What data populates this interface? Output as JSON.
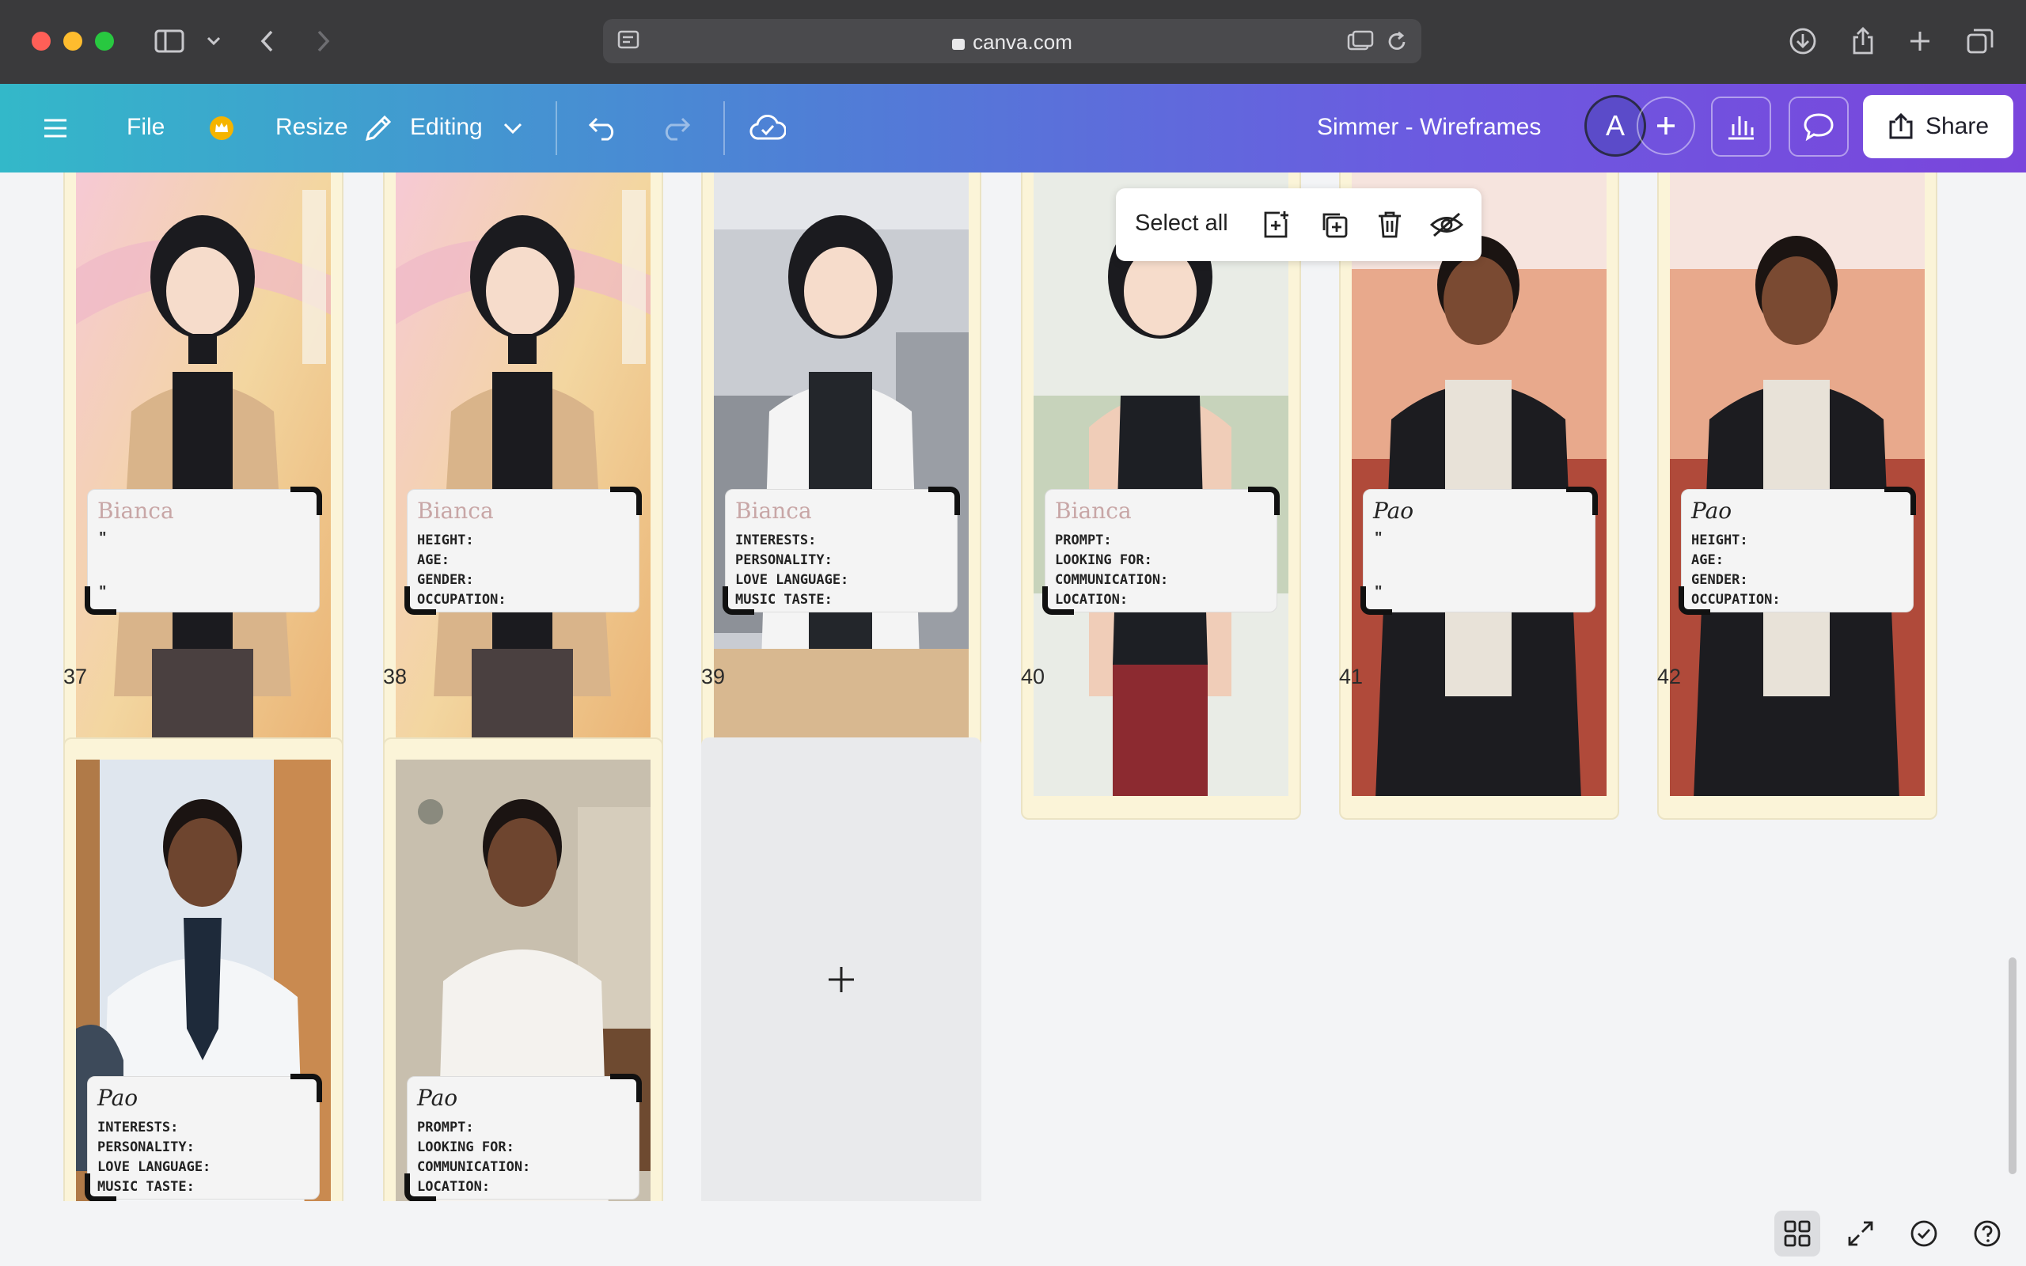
{
  "browser": {
    "url": "canva.com"
  },
  "toolbar": {
    "file_label": "File",
    "resize_label": "Resize",
    "editing_label": "Editing",
    "document_title": "Simmer - Wireframes",
    "avatar_initial": "A",
    "share_label": "Share"
  },
  "selection_toolbar": {
    "select_all_label": "Select all"
  },
  "pages_row1": [
    {
      "number": "37",
      "name": "Bianca",
      "lines": [],
      "quote": true
    },
    {
      "number": "38",
      "name": "Bianca",
      "lines": [
        "HEIGHT:",
        "AGE:",
        "GENDER:",
        "OCCUPATION:"
      ],
      "quote": false
    },
    {
      "number": "39",
      "name": "Bianca",
      "lines": [
        "INTERESTS:",
        "PERSONALITY:",
        "LOVE LANGUAGE:",
        "MUSIC TASTE:"
      ],
      "quote": false
    },
    {
      "number": "40",
      "name": "Bianca",
      "lines": [
        "PROMPT:",
        "LOOKING FOR:",
        "COMMUNICATION:",
        "LOCATION:"
      ],
      "quote": false
    },
    {
      "number": "41",
      "name": "Pao",
      "lines": [],
      "quote": true
    },
    {
      "number": "42",
      "name": "Pao",
      "lines": [
        "HEIGHT:",
        "AGE:",
        "GENDER:",
        "OCCUPATION:"
      ],
      "quote": false
    }
  ],
  "pages_row2": [
    {
      "name": "Pao",
      "lines": [
        "INTERESTS:",
        "PERSONALITY:",
        "LOVE LANGUAGE:",
        "MUSIC TASTE:"
      ]
    },
    {
      "name": "Pao",
      "lines": [
        "PROMPT:",
        "LOOKING FOR:",
        "COMMUNICATION:",
        "LOCATION:"
      ]
    }
  ],
  "quote_mark": "\"",
  "colors": {
    "toolbar_gradient_start": "#33b8c9",
    "toolbar_gradient_end": "#7a45dc",
    "page_border": "#fbf4d8"
  }
}
